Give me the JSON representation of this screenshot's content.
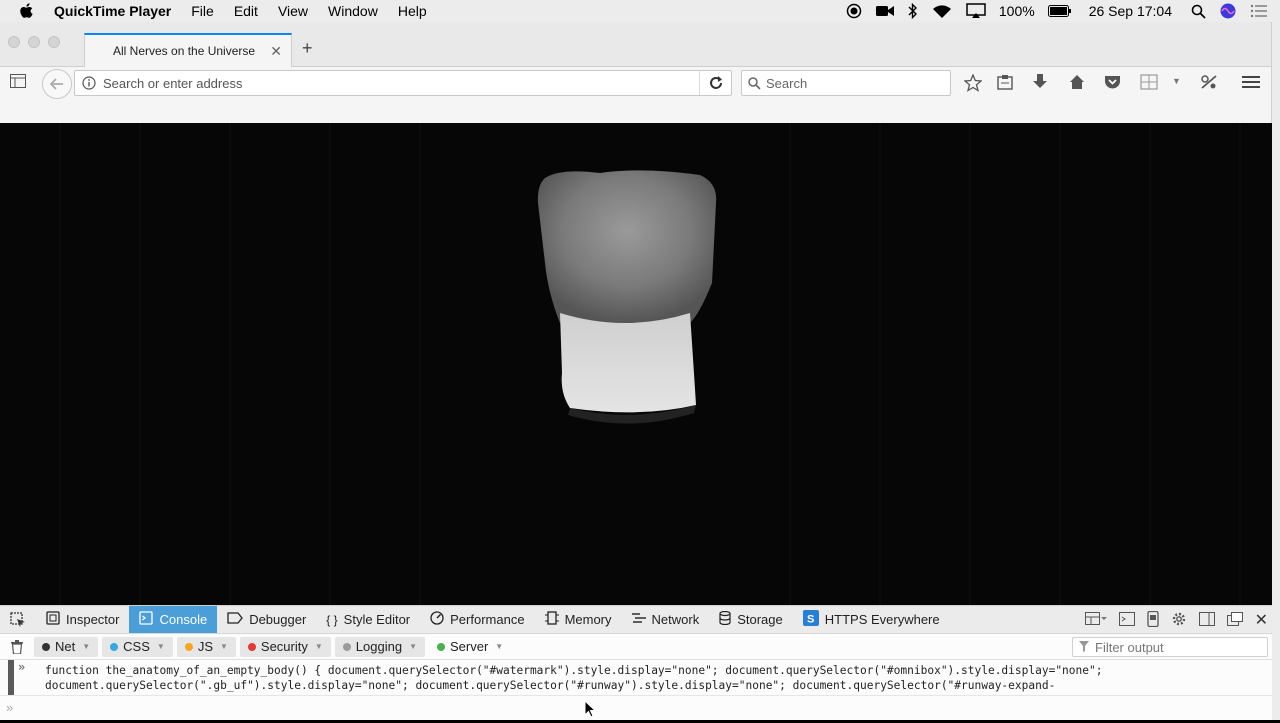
{
  "menubar": {
    "app_name": "QuickTime Player",
    "items": [
      "File",
      "Edit",
      "View",
      "Window",
      "Help"
    ],
    "battery": "100%",
    "datetime": "26 Sep  17:04"
  },
  "browser": {
    "tab_title": "All Nerves on the Universe",
    "address_placeholder": "Search or enter address",
    "search_placeholder": "Search"
  },
  "devtools": {
    "tabs": [
      "Inspector",
      "Console",
      "Debugger",
      "Style Editor",
      "Performance",
      "Memory",
      "Network",
      "Storage",
      "HTTPS Everywhere"
    ],
    "active_tab": "Console",
    "filters": [
      {
        "label": "Net",
        "color": "#333333"
      },
      {
        "label": "CSS",
        "color": "#3aa8e0"
      },
      {
        "label": "JS",
        "color": "#f5a623"
      },
      {
        "label": "Security",
        "color": "#e03a3a"
      },
      {
        "label": "Logging",
        "color": "#9a9a9a"
      },
      {
        "label": "Server",
        "color": "#4caf50"
      }
    ],
    "filter_placeholder": "Filter output",
    "console_line_1": "function the_anatomy_of_an_empty_body() { document.querySelector(\"#watermark\").style.display=\"none\"; document.querySelector(\"#omnibox\").style.display=\"none\";",
    "console_line_2": "document.querySelector(\".gb_uf\").style.display=\"none\"; document.querySelector(\"#runway\").style.display=\"none\"; document.querySelector(\"#runway-expand-"
  }
}
